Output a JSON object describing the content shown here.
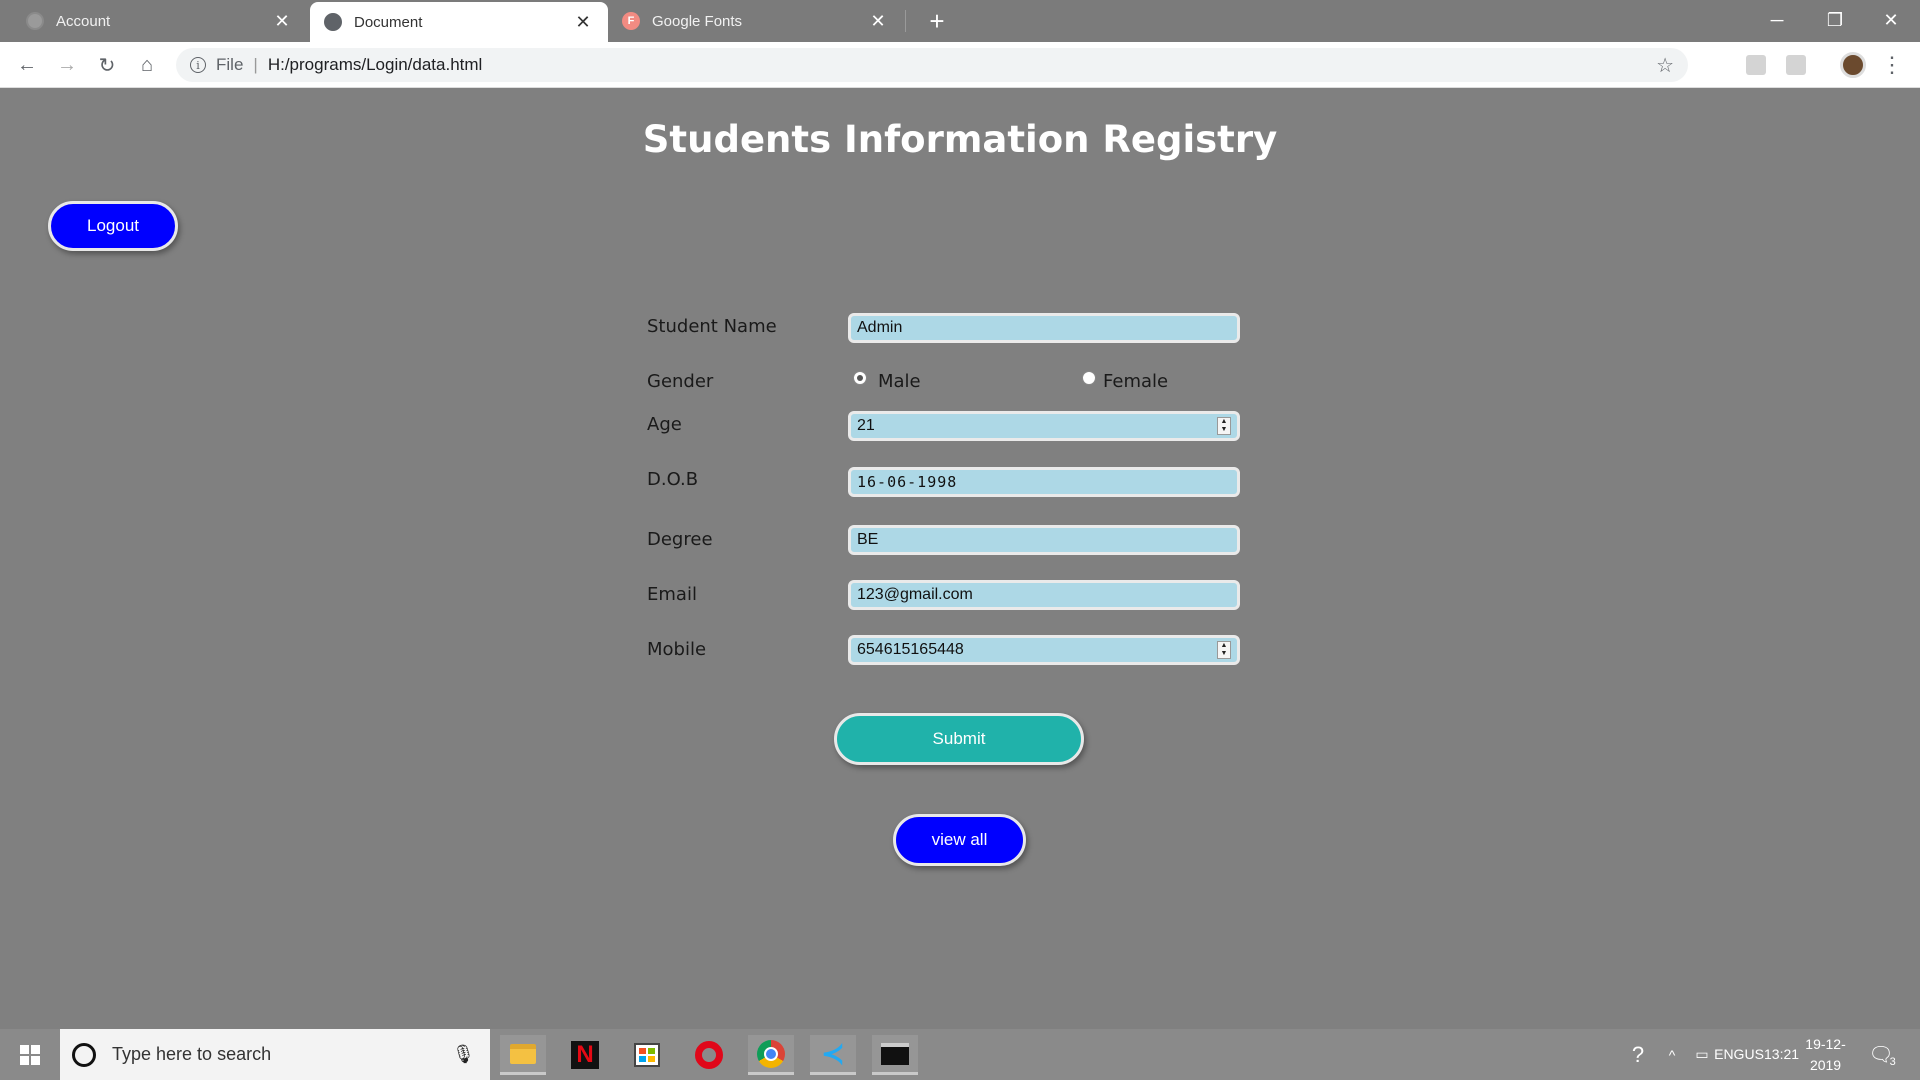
{
  "browser": {
    "tabs": [
      {
        "title": "Account"
      },
      {
        "title": "Document"
      },
      {
        "title": "Google Fonts",
        "favicon_letter": "F"
      }
    ],
    "new_tab": "+",
    "address": {
      "scheme_label": "File",
      "url": "H:/programs/Login/data.html"
    }
  },
  "page": {
    "title": "Students Information Registry",
    "logout_label": "Logout",
    "form": {
      "student_name": {
        "label": "Student Name",
        "value": "Admin"
      },
      "gender": {
        "label": "Gender",
        "options": [
          "Male",
          "Female"
        ],
        "selected": "Male"
      },
      "age": {
        "label": "Age",
        "value": "21"
      },
      "dob": {
        "label": "D.O.B",
        "value": "16-06-1998"
      },
      "degree": {
        "label": "Degree",
        "value": "BE"
      },
      "email": {
        "label": "Email",
        "value": "123@gmail.com"
      },
      "mobile": {
        "label": "Mobile",
        "value": "654615165448"
      }
    },
    "submit_label": "Submit",
    "view_all_label": "view all",
    "colors": {
      "background": "#808080",
      "field": "#add8e6",
      "logout": "#0000ff",
      "submit": "#20b2aa",
      "view_all": "#0000ff"
    }
  },
  "taskbar": {
    "search_placeholder": "Type here to search",
    "apps": [
      "file-explorer-icon",
      "netflix-icon",
      "store-icon",
      "opera-icon",
      "chrome-icon",
      "vscode-icon",
      "terminal-icon"
    ],
    "language": "ENG",
    "region": "US",
    "time": "13:21",
    "date": "19-12-2019",
    "notification_count": "3"
  }
}
